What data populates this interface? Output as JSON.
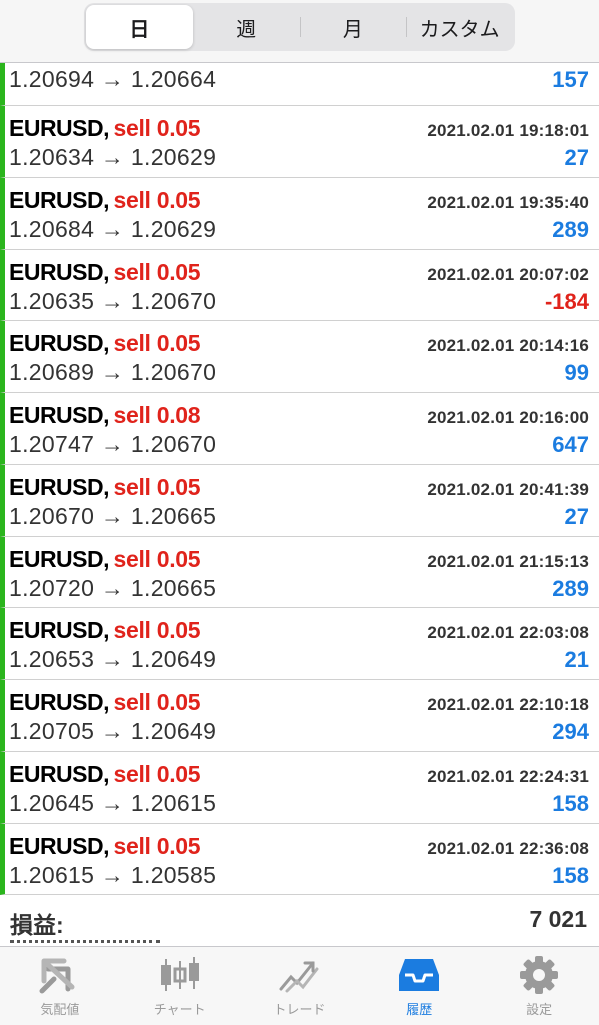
{
  "segments": [
    "日",
    "週",
    "月",
    "カスタム"
  ],
  "partial_row": {
    "prices": "1.20694 → 1.20664",
    "profit": "157"
  },
  "trades": [
    {
      "symbol": "EURUSD,",
      "side": "sell 0.05",
      "time": "2021.02.01 19:18:01",
      "prices": "1.20634 → 1.20629",
      "profit": "27"
    },
    {
      "symbol": "EURUSD,",
      "side": "sell 0.05",
      "time": "2021.02.01 19:35:40",
      "prices": "1.20684 → 1.20629",
      "profit": "289"
    },
    {
      "symbol": "EURUSD,",
      "side": "sell 0.05",
      "time": "2021.02.01 20:07:02",
      "prices": "1.20635 → 1.20670",
      "profit": "-184"
    },
    {
      "symbol": "EURUSD,",
      "side": "sell 0.05",
      "time": "2021.02.01 20:14:16",
      "prices": "1.20689 → 1.20670",
      "profit": "99"
    },
    {
      "symbol": "EURUSD,",
      "side": "sell 0.08",
      "time": "2021.02.01 20:16:00",
      "prices": "1.20747 → 1.20670",
      "profit": "647"
    },
    {
      "symbol": "EURUSD,",
      "side": "sell 0.05",
      "time": "2021.02.01 20:41:39",
      "prices": "1.20670 → 1.20665",
      "profit": "27"
    },
    {
      "symbol": "EURUSD,",
      "side": "sell 0.05",
      "time": "2021.02.01 21:15:13",
      "prices": "1.20720 → 1.20665",
      "profit": "289"
    },
    {
      "symbol": "EURUSD,",
      "side": "sell 0.05",
      "time": "2021.02.01 22:03:08",
      "prices": "1.20653 → 1.20649",
      "profit": "21"
    },
    {
      "symbol": "EURUSD,",
      "side": "sell 0.05",
      "time": "2021.02.01 22:10:18",
      "prices": "1.20705 → 1.20649",
      "profit": "294"
    },
    {
      "symbol": "EURUSD,",
      "side": "sell 0.05",
      "time": "2021.02.01 22:24:31",
      "prices": "1.20645 → 1.20615",
      "profit": "158"
    },
    {
      "symbol": "EURUSD,",
      "side": "sell 0.05",
      "time": "2021.02.01 22:36:08",
      "prices": "1.20615 → 1.20585",
      "profit": "158"
    }
  ],
  "summary": {
    "label": "損益:",
    "value": "7 021"
  },
  "tabs": [
    {
      "label": "気配値",
      "icon": "quotes-icon"
    },
    {
      "label": "チャート",
      "icon": "chart-icon"
    },
    {
      "label": "トレード",
      "icon": "trade-icon"
    },
    {
      "label": "履歴",
      "icon": "history-icon"
    },
    {
      "label": "設定",
      "icon": "settings-icon"
    }
  ],
  "colors": {
    "accent": "#1b7ce0",
    "loss": "#e0231b",
    "buy_marker": "#2bb51d"
  }
}
